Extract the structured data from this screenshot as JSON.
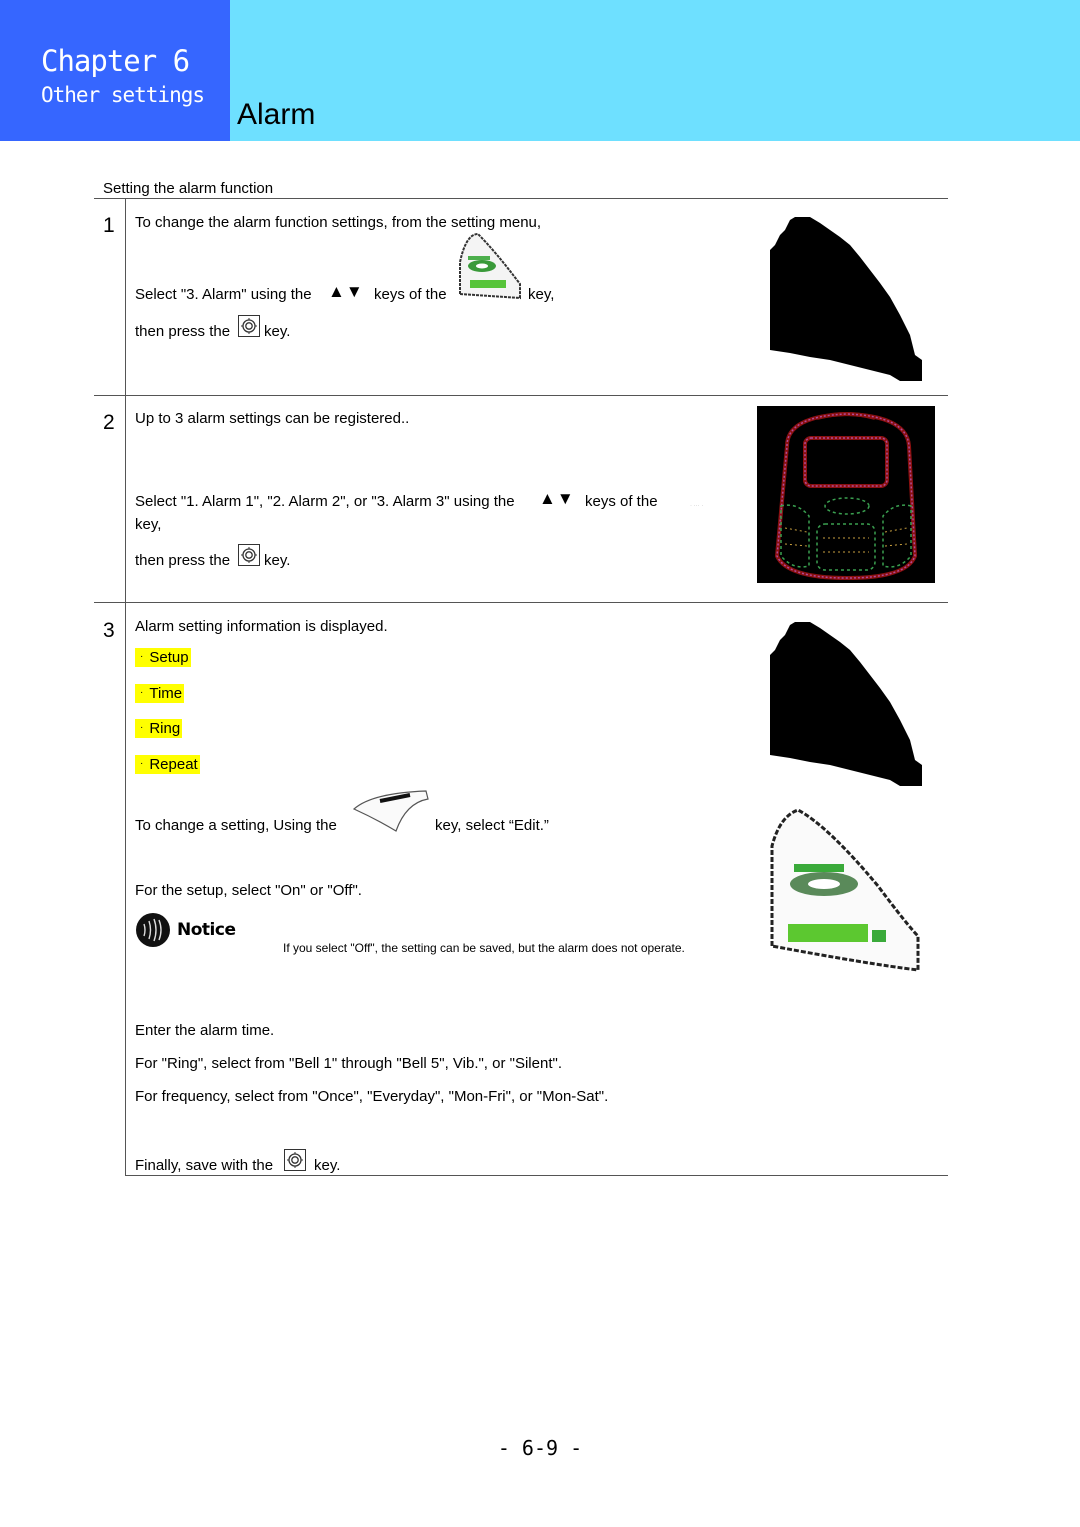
{
  "header": {
    "chapter": "Chapter 6",
    "chapter_subtitle": "Other settings",
    "page_title": "Alarm",
    "colors": {
      "chapter_bg": "#3666ff",
      "title_bg": "#6ee0ff"
    }
  },
  "section": {
    "title": "Setting the alarm function"
  },
  "steps": [
    {
      "number": "1",
      "lines": [
        "To change the alarm function settings, from the setting menu,",
        "Select \"3. Alarm\" using the",
        "keys of the",
        "key,",
        "then press the",
        "key."
      ],
      "icons": [
        "up-down-arrow-keys",
        "send-key",
        "ok-key",
        "phone-silhouette"
      ]
    },
    {
      "number": "2",
      "lines": [
        "Up to 3 alarm settings can be registered..",
        "Select \"1. Alarm 1\", \"2. Alarm 2\", or \"3. Alarm 3\" using the",
        "keys of the",
        "key,",
        "then press the",
        "key."
      ],
      "icons": [
        "up-down-arrow-keys",
        "ok-key",
        "phone-illustration"
      ]
    },
    {
      "number": "3",
      "intro": "Alarm setting information is displayed.",
      "items": [
        "Setup",
        "Time",
        "Ring",
        "Repeat"
      ],
      "item_bullet": "·",
      "highlight_color": "#ffff00",
      "edit_line_before": "To change a setting, Using the",
      "edit_line_after": "key, select “Edit.”",
      "setup_line": "For the setup, select \"On\" or \"Off\".",
      "notice": {
        "label": "Notice",
        "text": "If you select \"Off\", the setting can be saved, but the alarm does not operate."
      },
      "time_line": "Enter the alarm time.",
      "ring_line": "For \"Ring\", select from \"Bell 1\" through \"Bell 5\", Vib.\", or \"Silent\".",
      "frequency_line": "For frequency, select from \"Once\", \"Everyday\", \"Mon-Fri\", or \"Mon-Sat\".",
      "save_before": "Finally, save with the",
      "save_after": "key.",
      "icons": [
        "soft-key-left",
        "ok-key",
        "phone-silhouette",
        "send-key-large"
      ]
    }
  ],
  "arrows_glyph": "▲▼",
  "footer": {
    "page_number": "- 6-9 -"
  }
}
